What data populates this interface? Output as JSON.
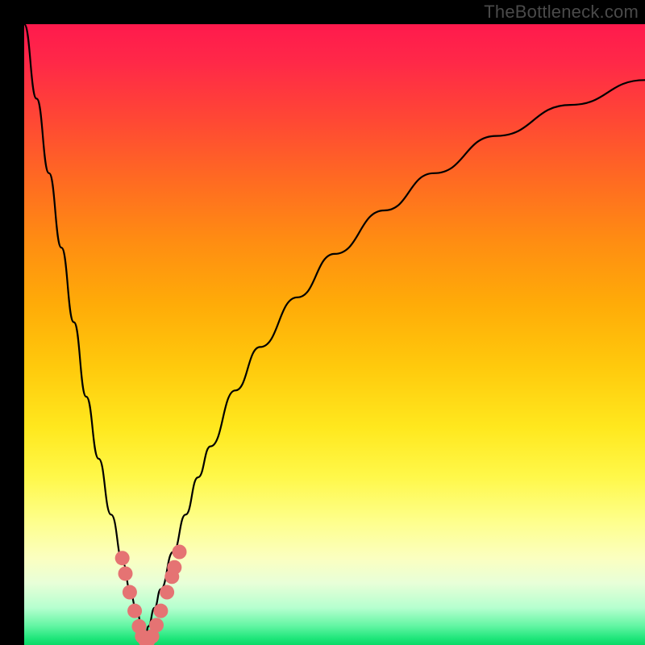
{
  "watermark": "TheBottleneck.com",
  "colors": {
    "curve_stroke": "#000000",
    "marker_fill": "#e57373",
    "marker_stroke": "#bf5a5a",
    "gradient_top": "#ff1a4d",
    "gradient_bottom": "#0bd867",
    "frame": "#000000"
  },
  "chart_data": {
    "type": "line",
    "title": "",
    "xlabel": "",
    "ylabel": "",
    "xlim": [
      0,
      100
    ],
    "ylim": [
      0,
      100
    ],
    "grid": false,
    "legend": false,
    "series": [
      {
        "name": "left_branch",
        "x": [
          0,
          2,
          4,
          6,
          8,
          10,
          12,
          14,
          16,
          17,
          18,
          19,
          19.5
        ],
        "values": [
          100,
          88,
          76,
          64,
          52,
          40,
          30,
          21,
          13,
          9,
          6,
          3,
          1
        ]
      },
      {
        "name": "right_branch",
        "x": [
          19.5,
          20,
          21,
          22,
          24,
          26,
          28,
          30,
          34,
          38,
          44,
          50,
          58,
          66,
          76,
          88,
          100
        ],
        "values": [
          1,
          3,
          6,
          9,
          15,
          21,
          27,
          32,
          41,
          48,
          56,
          63,
          70,
          76,
          82,
          87,
          91
        ]
      }
    ],
    "markers": [
      {
        "x": 15.8,
        "y": 14.0
      },
      {
        "x": 16.3,
        "y": 11.5
      },
      {
        "x": 17.0,
        "y": 8.5
      },
      {
        "x": 17.8,
        "y": 5.5
      },
      {
        "x": 18.5,
        "y": 3.0
      },
      {
        "x": 19.0,
        "y": 1.4
      },
      {
        "x": 19.5,
        "y": 0.8
      },
      {
        "x": 20.0,
        "y": 0.8
      },
      {
        "x": 20.6,
        "y": 1.4
      },
      {
        "x": 21.3,
        "y": 3.2
      },
      {
        "x": 22.0,
        "y": 5.5
      },
      {
        "x": 23.0,
        "y": 8.5
      },
      {
        "x": 23.8,
        "y": 11.0
      },
      {
        "x": 24.2,
        "y": 12.5
      },
      {
        "x": 25.0,
        "y": 15.0
      }
    ],
    "annotations": []
  }
}
